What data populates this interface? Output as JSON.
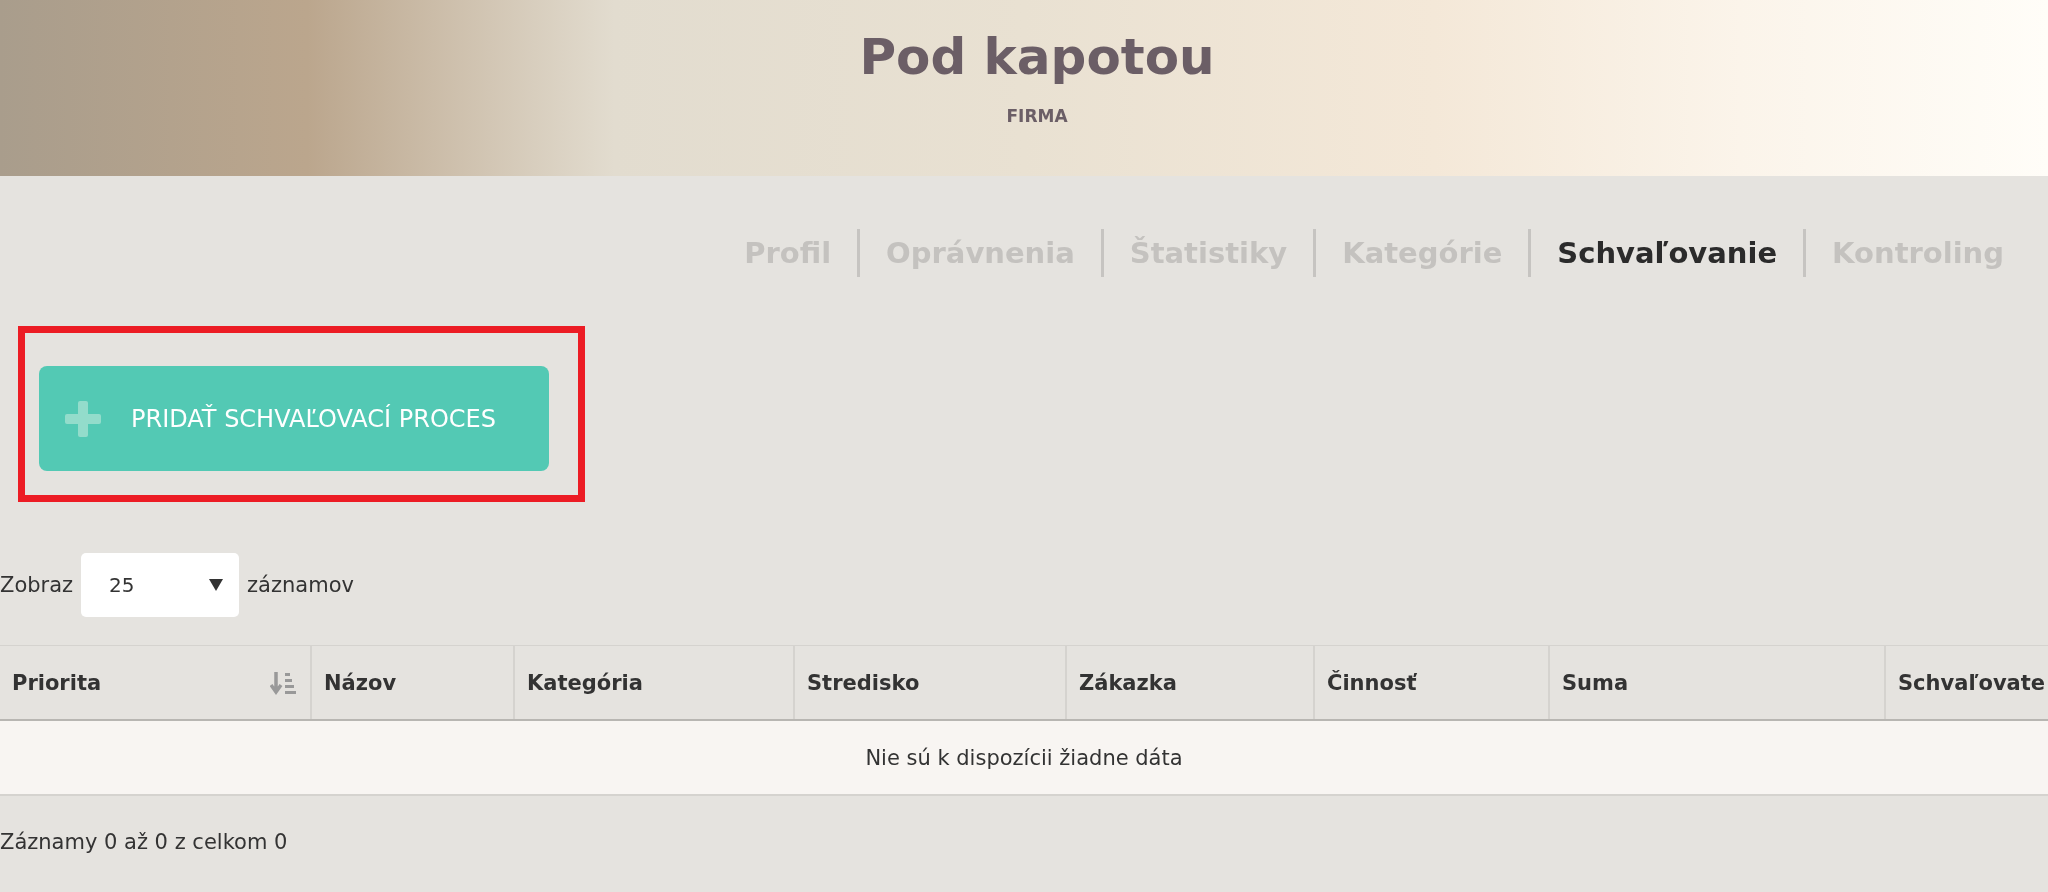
{
  "header": {
    "title": "Pod kapotou",
    "subtitle": "FIRMA"
  },
  "tabs": [
    {
      "label": "Profil",
      "selected": false
    },
    {
      "label": "Oprávnenia",
      "selected": false
    },
    {
      "label": "Štatistiky",
      "selected": false
    },
    {
      "label": "Kategórie",
      "selected": false
    },
    {
      "label": "Schvaľovanie",
      "selected": true
    },
    {
      "label": "Kontroling",
      "selected": false
    }
  ],
  "add_button": {
    "label": "PRIDAŤ SCHVAĽOVACÍ PROCES",
    "highlighted": true
  },
  "page_size": {
    "prefix": "Zobraz",
    "value": "25",
    "suffix": "záznamov"
  },
  "table": {
    "columns": [
      {
        "label": "Priorita",
        "sorted": true
      },
      {
        "label": "Názov",
        "sorted": false
      },
      {
        "label": "Kategória",
        "sorted": false
      },
      {
        "label": "Stredisko",
        "sorted": false
      },
      {
        "label": "Zákazka",
        "sorted": false
      },
      {
        "label": "Činnosť",
        "sorted": false
      },
      {
        "label": "Suma",
        "sorted": false
      },
      {
        "label": "Schvaľovate",
        "sorted": false
      }
    ],
    "empty_message": "Nie sú k dispozícii žiadne dáta"
  },
  "footer": {
    "info": "Záznamy 0 až 0 z celkom 0"
  }
}
